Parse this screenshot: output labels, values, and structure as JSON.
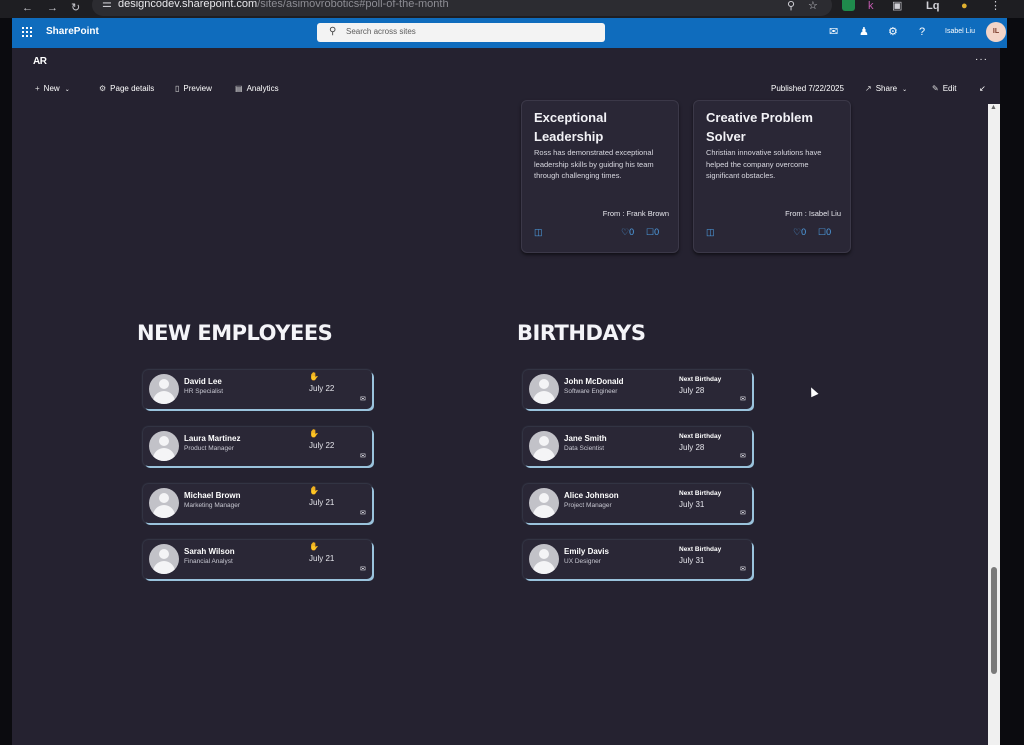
{
  "browser": {
    "url_host": "designcodev.sharepoint.com",
    "url_path": "/sites/asimovrobotics#poll-of-the-month",
    "profile_label": "Lq"
  },
  "suite_bar": {
    "brand": "SharePoint",
    "search_placeholder": "Search across sites",
    "user_name": "Isabel Liu",
    "user_initials": "IL"
  },
  "site": {
    "logo": "AR",
    "more": "···"
  },
  "command_bar": {
    "new_label": "New",
    "page_details_label": "Page details",
    "preview_label": "Preview",
    "analytics_label": "Analytics",
    "published_label": "Published 7/22/2025",
    "share_label": "Share",
    "edit_label": "Edit"
  },
  "kudos_cards": [
    {
      "title": "Exceptional Leadership",
      "description": "Ross has demonstrated exceptional leadership skills by guiding his team through challenging times.",
      "from": "From : Frank Brown",
      "likes": "0",
      "comments": "0"
    },
    {
      "title": "Creative Problem Solver",
      "description": "Christian innovative solutions have helped the company overcome significant obstacles.",
      "from": "From : Isabel Liu",
      "likes": "0",
      "comments": "0"
    }
  ],
  "new_employees": {
    "title": "NEW EMPLOYEES",
    "items": [
      {
        "name": "David Lee",
        "role": "HR Specialist",
        "date": "July 22"
      },
      {
        "name": "Laura Martinez",
        "role": "Product Manager",
        "date": "July 22"
      },
      {
        "name": "Michael Brown",
        "role": "Marketing Manager",
        "date": "July 21"
      },
      {
        "name": "Sarah Wilson",
        "role": "Financial Analyst",
        "date": "July 21"
      }
    ]
  },
  "birthdays": {
    "title": "BIRTHDAYS",
    "next_label": "Next Birthday",
    "items": [
      {
        "name": "John McDonald",
        "role": "Software Engineer",
        "date": "July 28"
      },
      {
        "name": "Jane Smith",
        "role": "Data Scientist",
        "date": "July 28"
      },
      {
        "name": "Alice Johnson",
        "role": "Project Manager",
        "date": "July 31"
      },
      {
        "name": "Emily Davis",
        "role": "UX Designer",
        "date": "July 31"
      }
    ]
  },
  "colors": {
    "suite_bar": "#0f6cbd",
    "page_background": "#252230",
    "card_background": "#2a2736",
    "accent_blue": "#4ea1e8",
    "card_edge": "#9ac3dc"
  }
}
